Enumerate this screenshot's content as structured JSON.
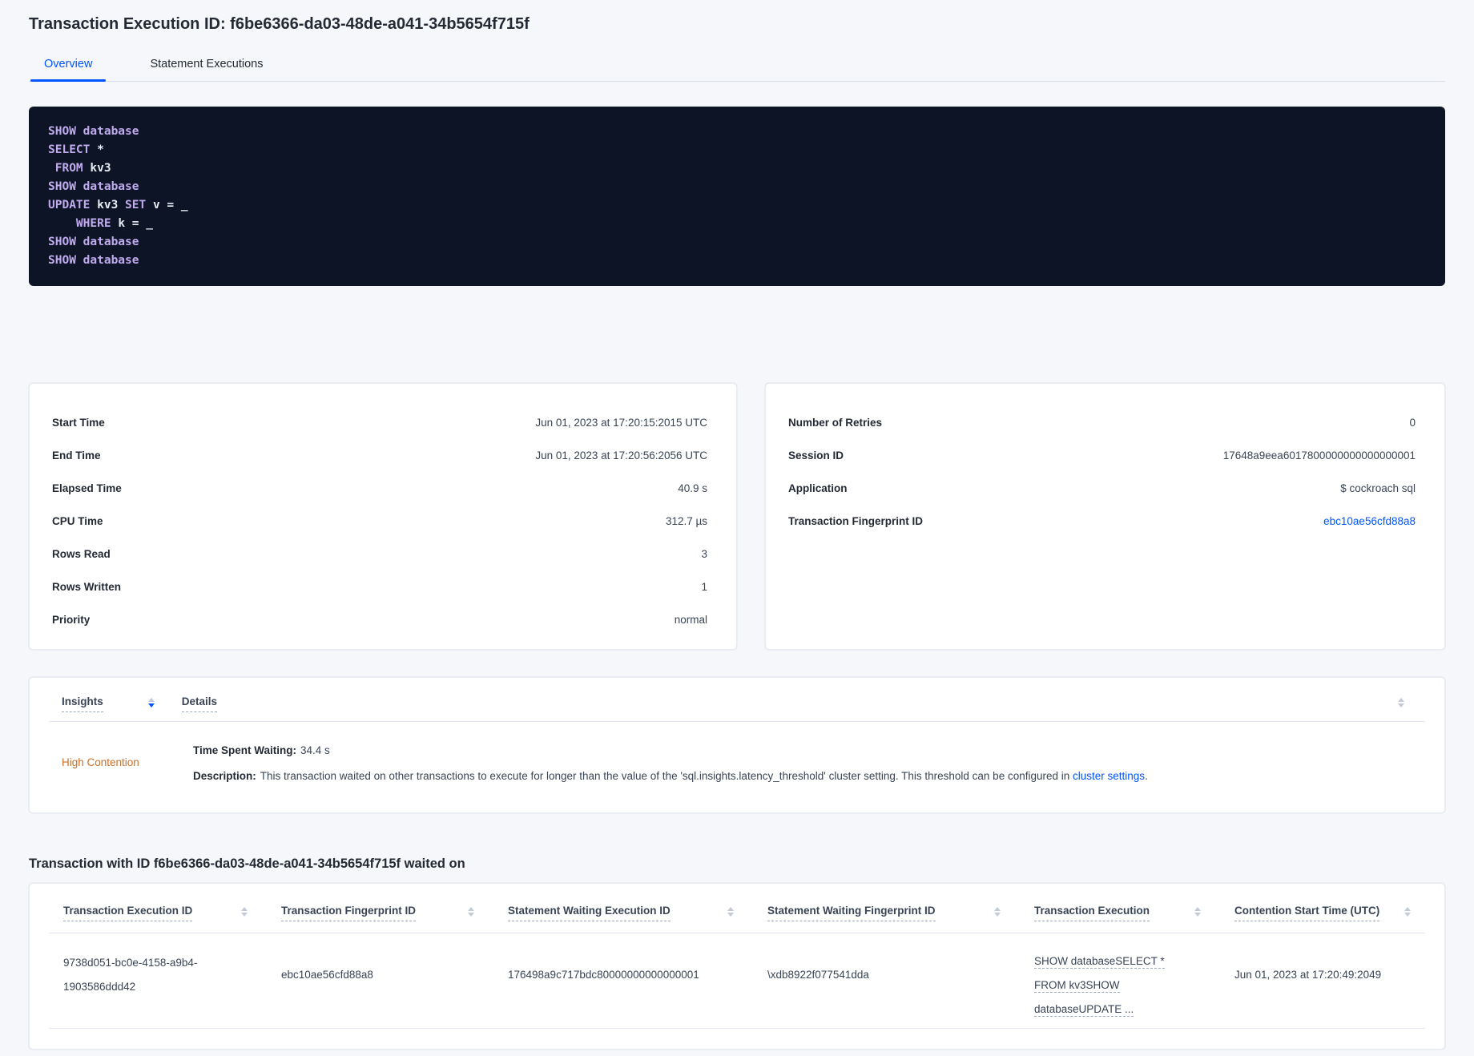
{
  "colors": {
    "accent_blue": "#0055ff",
    "insight_orange": "#c9702b",
    "code_background": "#0d1426",
    "code_keyword": "#c0abee",
    "code_plain": "#e7ecf3"
  },
  "icons": {
    "sort": "sort-arrows"
  },
  "header": {
    "title": "Transaction Execution ID: f6be6366-da03-48de-a041-34b5654f715f",
    "tabs": [
      {
        "label": "Overview"
      },
      {
        "label": "Statement Executions"
      }
    ]
  },
  "sql_box": {
    "lines": [
      [
        {
          "t": "SHOW database",
          "c": "kw"
        }
      ],
      [
        {
          "t": "SELECT ",
          "c": "kw"
        },
        {
          "t": "*",
          "c": "pl"
        }
      ],
      [
        {
          "t": " FROM ",
          "c": "kw"
        },
        {
          "t": "kv3",
          "c": "pl"
        }
      ],
      [
        {
          "t": "SHOW database",
          "c": "kw"
        }
      ],
      [
        {
          "t": "UPDATE ",
          "c": "kw"
        },
        {
          "t": "kv3 ",
          "c": "pl"
        },
        {
          "t": "SET ",
          "c": "kw"
        },
        {
          "t": "v = _",
          "c": "pl"
        }
      ],
      [
        {
          "t": "    WHERE ",
          "c": "kw"
        },
        {
          "t": "k = _",
          "c": "pl"
        }
      ],
      [
        {
          "t": "SHOW database",
          "c": "kw"
        }
      ],
      [
        {
          "t": "SHOW database",
          "c": "kw"
        }
      ]
    ]
  },
  "summary_left": {
    "rows": [
      {
        "label": "Start Time",
        "value": "Jun 01, 2023 at 17:20:15:2015 UTC"
      },
      {
        "label": "End Time",
        "value": "Jun 01, 2023 at 17:20:56:2056 UTC"
      },
      {
        "label": "Elapsed Time",
        "value": "40.9 s"
      },
      {
        "label": "CPU Time",
        "value": "312.7 µs"
      },
      {
        "label": "Rows Read",
        "value": "3"
      },
      {
        "label": "Rows Written",
        "value": "1"
      },
      {
        "label": "Priority",
        "value": "normal"
      }
    ]
  },
  "summary_right": {
    "rows": [
      {
        "label": "Number of Retries",
        "value": "0"
      },
      {
        "label": "Session ID",
        "value": "17648a9eea6017800000000000000001"
      },
      {
        "label": "Application",
        "value": "$ cockroach sql"
      },
      {
        "label": "Transaction Fingerprint ID",
        "value": "ebc10ae56cfd88a8"
      }
    ]
  },
  "insights": {
    "col_insights": "Insights",
    "col_details": "Details",
    "row": {
      "insight": "High Contention",
      "waiting_label": "Time Spent Waiting:",
      "waiting_value": "34.4 s",
      "description_label": "Description:",
      "description_text": "This transaction waited on other transactions to execute for longer than the value of the 'sql.insights.latency_threshold' cluster setting. This threshold can be configured in ",
      "description_link": "cluster settings",
      "description_end": "."
    }
  },
  "waited_on": {
    "heading": "Transaction with ID f6be6366-da03-48de-a041-34b5654f715f waited on",
    "columns": [
      "Transaction Execution ID",
      "Transaction Fingerprint ID",
      "Statement Waiting Execution ID",
      "Statement Waiting Fingerprint ID",
      "Transaction Execution",
      "Contention Start Time (UTC)"
    ],
    "row": {
      "transaction_execution_id": "9738d051-bc0e-4158-a9b4-1903586ddd42",
      "transaction_fingerprint_id": "ebc10ae56cfd88a8",
      "statement_waiting_execution_id": "176498a9c717bdc80000000000000001",
      "statement_waiting_fingerprint_id": "\\xdb8922f077541dda",
      "transaction_execution_lines": [
        "SHOW databaseSELECT *",
        "FROM kv3SHOW",
        "databaseUPDATE ..."
      ],
      "contention_start_time": "Jun 01, 2023 at 17:20:49:2049"
    }
  }
}
